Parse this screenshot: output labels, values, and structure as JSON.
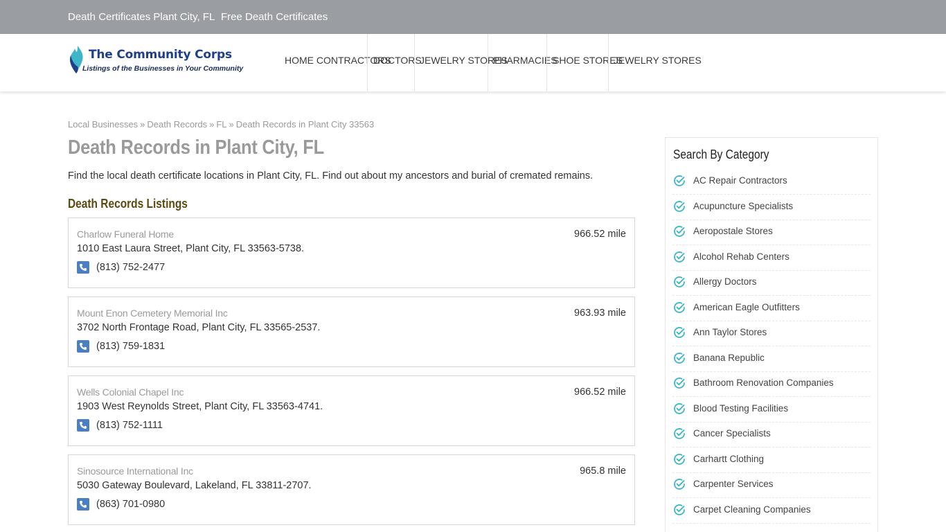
{
  "topbar": {
    "links": [
      "Death Certificates Plant City, FL",
      "Free Death Certificates"
    ]
  },
  "logo": {
    "title": "The Community Corps",
    "tagline": "Listings of the Businesses in Your Community"
  },
  "nav": {
    "items": [
      "HOME CONTRACTORS",
      "DOCTORS",
      "JEWELRY STORES",
      "PHARMACIES",
      "SHOE STORES",
      "JEWELRY STORES"
    ]
  },
  "breadcrumb": [
    "Local Businesses",
    "Death Records",
    "FL",
    "Death Records in Plant City 33563"
  ],
  "breadcrumb_separator": "»",
  "page": {
    "title": "Death Records in Plant City, FL",
    "intro": "Find the local death certificate locations in Plant City, FL. Find out about my ancestors and burial of cremated remains.",
    "listings_heading": "Death Records Listings"
  },
  "listings": [
    {
      "name": "Charlow Funeral Home",
      "address": "1010 East Laura Street, Plant City, FL 33563-5738.",
      "phone": "(813) 752-2477",
      "distance": "966.52 mile"
    },
    {
      "name": "Mount Enon Cemetery Memorial Inc",
      "address": "3702 North Frontage Road, Plant City, FL 33565-2537.",
      "phone": "(813) 759-1831",
      "distance": "963.93 mile"
    },
    {
      "name": "Wells Colonial Chapel Inc",
      "address": "1903 West Reynolds Street, Plant City, FL 33563-4741.",
      "phone": "(813) 752-1111",
      "distance": "966.52 mile"
    },
    {
      "name": "Sinosource International Inc",
      "address": "5030 Gateway Boulevard, Lakeland, FL 33811-2707.",
      "phone": "(863) 701-0980",
      "distance": "965.8 mile"
    }
  ],
  "sidebar": {
    "title": "Search By Category",
    "categories": [
      "AC Repair Contractors",
      "Acupuncture Specialists",
      "Aeropostale Stores",
      "Alcohol Rehab Centers",
      "Allergy Doctors",
      "American Eagle Outfitters",
      "Ann Taylor Stores",
      "Banana Republic",
      "Bathroom Renovation Companies",
      "Blood Testing Facilities",
      "Cancer Specialists",
      "Carhartt Clothing",
      "Carpenter Services",
      "Carpet Cleaning Companies"
    ]
  },
  "colors": {
    "topbar": "#9a9da1",
    "logo_blue": "#1f3f8c",
    "logo_teal": "#3fb6c8",
    "phone_icon": "#4a7fc4",
    "check_icon": "#3fb6c8",
    "listings_heading": "#5c4a12"
  },
  "icons": {
    "phone": "phone-icon",
    "category": "check-circle-icon",
    "logo": "flame-logo-icon"
  }
}
